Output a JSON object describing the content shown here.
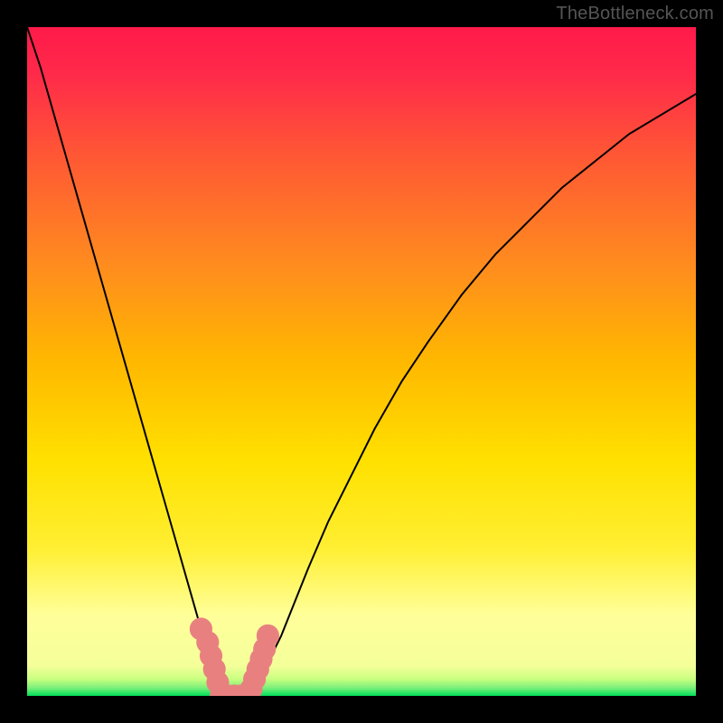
{
  "watermark": "TheBottleneck.com",
  "chart_data": {
    "type": "line",
    "title": "",
    "xlabel": "",
    "ylabel": "",
    "xlim": [
      0,
      100
    ],
    "ylim": [
      0,
      100
    ],
    "grid": false,
    "legend": false,
    "background_gradient": {
      "top_color": "#ff1a4a",
      "mid_color": "#ffd400",
      "bottom_band_color": "#ffff9a",
      "bottom_edge_color": "#00e05a"
    },
    "series": [
      {
        "name": "bottleneck_curve",
        "color": "#000000",
        "x": [
          0,
          2,
          4,
          6,
          8,
          10,
          12,
          14,
          16,
          18,
          20,
          22,
          24,
          26,
          28,
          29,
          30,
          31,
          32,
          33,
          34,
          36,
          38,
          40,
          42,
          45,
          48,
          52,
          56,
          60,
          65,
          70,
          75,
          80,
          85,
          90,
          95,
          100
        ],
        "y": [
          100,
          94,
          87,
          80,
          73,
          66,
          59,
          52,
          45,
          38,
          31,
          24,
          17,
          10,
          3,
          0,
          0,
          0,
          0,
          0,
          1,
          5,
          9,
          14,
          19,
          26,
          32,
          40,
          47,
          53,
          60,
          66,
          71,
          76,
          80,
          84,
          87,
          90
        ]
      }
    ],
    "markers": {
      "name": "highlight_band",
      "color": "#e98080",
      "radius_pct": 1.7,
      "points_x": [
        26,
        27,
        27.5,
        28,
        28.5,
        29,
        30,
        31,
        32,
        33,
        33.5,
        34,
        34.5,
        35,
        35.5,
        36
      ],
      "points_y": [
        10,
        8,
        6,
        4,
        2,
        0,
        0,
        0,
        0,
        0,
        1,
        2.5,
        4,
        5.5,
        7,
        9
      ]
    }
  }
}
